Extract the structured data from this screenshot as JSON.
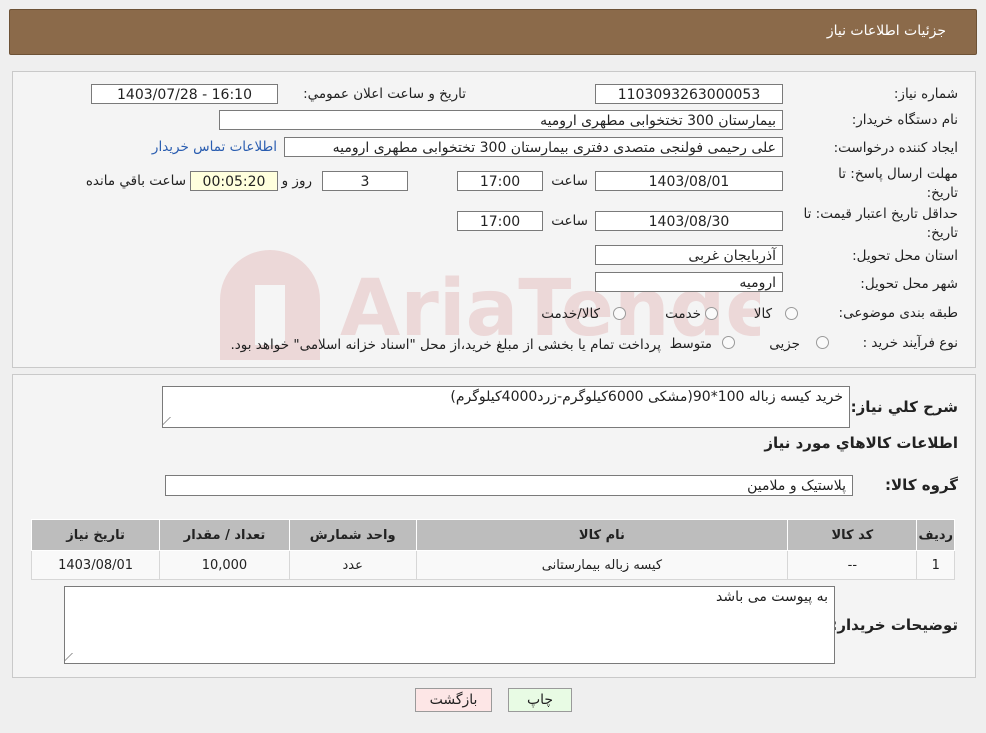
{
  "header": {
    "title": "جزئیات اطلاعات نیاز"
  },
  "form": {
    "need_number_label": "شماره نیاز:",
    "need_number": "1103093263000053",
    "announce_label": "تاریخ و ساعت اعلان عمومي:",
    "announce_value": "1403/07/28 - 16:10",
    "buyer_org_label": "نام دستگاه خريدار:",
    "buyer_org": "بیمارستان 300 تختخوابی مطهری  ارومیه",
    "requester_label": "ايجاد کننده درخواست:",
    "requester": "علی رحیمی فولنجی متصدی دفتری بیمارستان 300 تختخوابی مطهری  ارومیه",
    "contact_link": "اطلاعات تماس خريدار",
    "deadline_label": "مهلت ارسال پاسخ: تا تاریخ:",
    "deadline_date": "1403/08/01",
    "time_label": "ساعت",
    "deadline_time": "17:00",
    "days": "3",
    "days_label": "روز و",
    "remaining": "00:05:20",
    "remaining_label": "ساعت باقي مانده",
    "price_valid_label": "حداقل تاريخ اعتبار قيمت: تا تاريخ:",
    "price_valid_date": "1403/08/30",
    "price_valid_time": "17:00",
    "province_label": "استان محل تحويل:",
    "province": "آذربايجان غربی",
    "city_label": "شهر محل تحويل:",
    "city": "ارومیه",
    "category_label": "طبقه بندی موضوعی:",
    "category_options": [
      "کالا",
      "خدمت",
      "کالا/خدمت"
    ],
    "process_label": "نوع فرآيند خريد :",
    "process_options": [
      "جزیی",
      "متوسط"
    ],
    "process_note": "پرداخت تمام یا بخشی از مبلغ خرید،از محل \"اسناد خزانه اسلامی\" خواهد بود."
  },
  "summary": {
    "desc_label": "شرح کلي نياز:",
    "desc": "خرید کیسه زباله 100*90(مشکی 6000کیلوگرم-زرد4000کیلوگرم)",
    "goods_info_title": "اطلاعات کالاهاي مورد نياز",
    "group_label": "گروه کالا:",
    "group": "پلاستیک و ملامین"
  },
  "table": {
    "headers": [
      "رديف",
      "کد کالا",
      "نام کالا",
      "واحد شمارش",
      "تعداد / مقدار",
      "تاريخ نياز"
    ],
    "rows": [
      {
        "row": "1",
        "code": "--",
        "name": "کیسه زباله بیمارستانی",
        "unit": "عدد",
        "qty": "10,000",
        "date": "1403/08/01"
      }
    ]
  },
  "notes": {
    "label": "توضيحات خريدار:",
    "text": "به پیوست می باشد"
  },
  "buttons": {
    "print": "چاپ",
    "back": "بازگشت"
  },
  "watermark": {
    "text": "AriaTender.neT"
  }
}
